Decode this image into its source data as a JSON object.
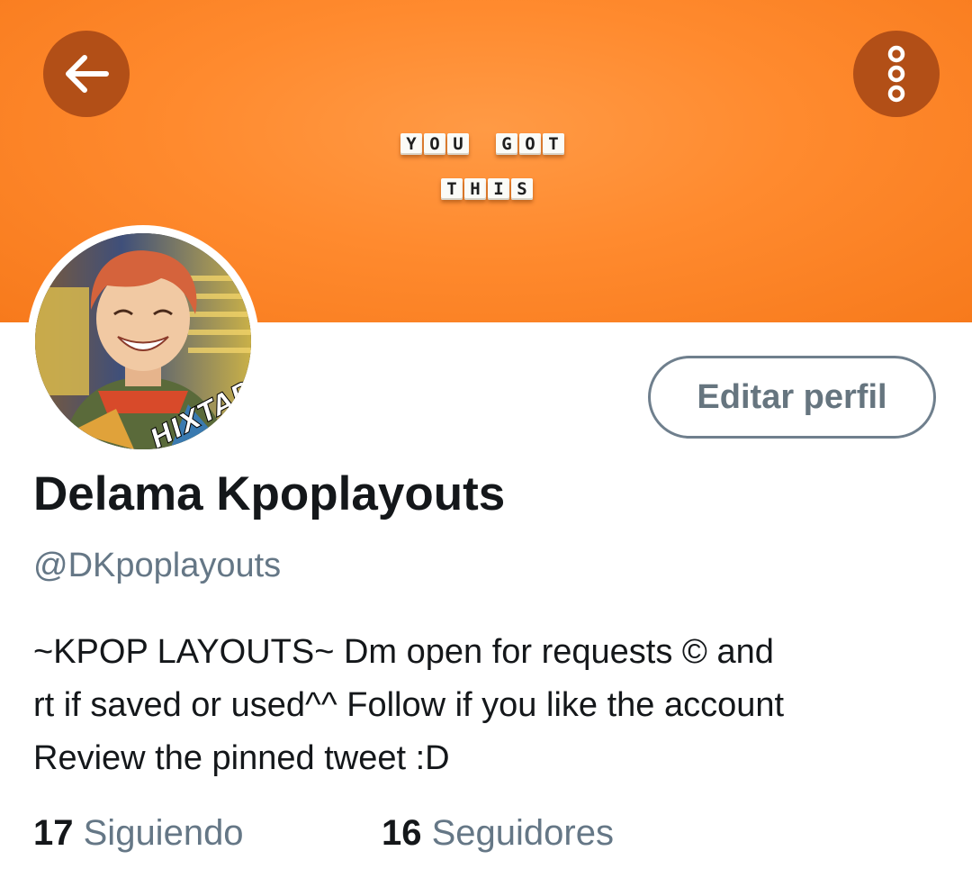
{
  "colors": {
    "banner": "#ff8a2e",
    "banner_button": "#b24f17",
    "text_primary": "#14171a",
    "text_secondary": "#657786",
    "button_border": "#6f7f8d"
  },
  "header": {
    "back_icon": "arrow-left-icon",
    "more_icon": "vertical-dots-icon",
    "banner_tiles": {
      "row1_word1": [
        "Y",
        "O",
        "U"
      ],
      "row1_word2": [
        "G",
        "O",
        "T"
      ],
      "row2": [
        "T",
        "H",
        "I",
        "S"
      ]
    }
  },
  "profile": {
    "avatar_text": "HIXTAPE",
    "edit_button_label": "Editar perfil",
    "display_name": "Delama Kpoplayouts",
    "handle": "@DKpoplayouts",
    "bio_lines": [
      "~KPOP LAYOUTS~ Dm open for requests  © and",
      "rt if saved or used^^ Follow if you like the account",
      "Review the pinned tweet :D"
    ]
  },
  "stats": {
    "following_count": "17",
    "following_label": "Siguiendo",
    "followers_count": "16",
    "followers_label": "Seguidores"
  }
}
